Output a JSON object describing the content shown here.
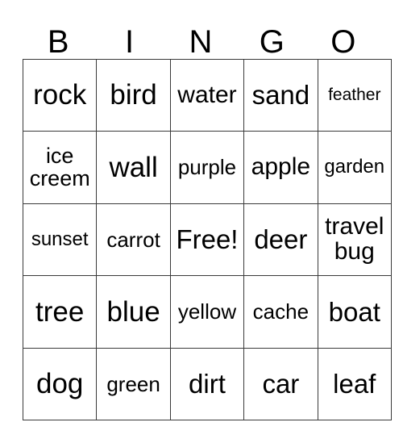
{
  "card": {
    "header_letters": [
      "B",
      "I",
      "N",
      "G",
      "O"
    ],
    "free_space_label": "Free!",
    "rows": [
      [
        {
          "text": "rock",
          "size": "fs-xxl",
          "lines": 1
        },
        {
          "text": "bird",
          "size": "fs-xxl",
          "lines": 1
        },
        {
          "text": "water",
          "size": "fs-l",
          "lines": 1
        },
        {
          "text": "sand",
          "size": "fs-xl",
          "lines": 1
        },
        {
          "text": "feather",
          "size": "fs-xs",
          "lines": 1
        }
      ],
      [
        {
          "text": "ice\ncreem",
          "size": "fs-ml",
          "lines": 2
        },
        {
          "text": "wall",
          "size": "fs-xxl",
          "lines": 1
        },
        {
          "text": "purple",
          "size": "fs-m",
          "lines": 1
        },
        {
          "text": "apple",
          "size": "fs-l",
          "lines": 1
        },
        {
          "text": "garden",
          "size": "fs-s",
          "lines": 1
        }
      ],
      [
        {
          "text": "sunset",
          "size": "fs-s",
          "lines": 1
        },
        {
          "text": "carrot",
          "size": "fs-m",
          "lines": 1
        },
        {
          "text": "Free!",
          "size": "fs-xl",
          "lines": 1
        },
        {
          "text": "deer",
          "size": "fs-xl",
          "lines": 1
        },
        {
          "text": "travel\nbug",
          "size": "fs-l",
          "lines": 2
        }
      ],
      [
        {
          "text": "tree",
          "size": "fs-xxl",
          "lines": 1
        },
        {
          "text": "blue",
          "size": "fs-xxl",
          "lines": 1
        },
        {
          "text": "yellow",
          "size": "fs-m",
          "lines": 1
        },
        {
          "text": "cache",
          "size": "fs-m",
          "lines": 1
        },
        {
          "text": "boat",
          "size": "fs-xl",
          "lines": 1
        }
      ],
      [
        {
          "text": "dog",
          "size": "fs-xxl",
          "lines": 1
        },
        {
          "text": "green",
          "size": "fs-m",
          "lines": 1
        },
        {
          "text": "dirt",
          "size": "fs-xl",
          "lines": 1
        },
        {
          "text": "car",
          "size": "fs-xl",
          "lines": 1
        },
        {
          "text": "leaf",
          "size": "fs-xl",
          "lines": 1
        }
      ]
    ]
  },
  "colors": {
    "background": "#ffffff",
    "grid_line": "#3a3a3a",
    "text": "#000000"
  }
}
